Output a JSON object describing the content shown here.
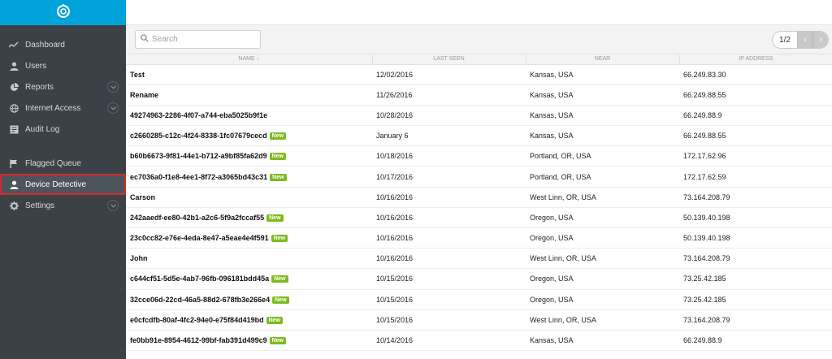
{
  "sidebar": {
    "items": [
      {
        "label": "Dashboard",
        "icon": "chart-line-icon",
        "chevron": false
      },
      {
        "label": "Users",
        "icon": "user-icon",
        "chevron": false
      },
      {
        "label": "Reports",
        "icon": "pie-chart-icon",
        "chevron": true
      },
      {
        "label": "Internet Access",
        "icon": "globe-icon",
        "chevron": true
      },
      {
        "label": "Audit Log",
        "icon": "log-icon",
        "chevron": false
      },
      {
        "label": "Flagged Queue",
        "icon": "flag-icon",
        "chevron": false
      },
      {
        "label": "Device Detective",
        "icon": "user-icon",
        "chevron": false,
        "active": true
      },
      {
        "label": "Settings",
        "icon": "gear-icon",
        "chevron": true
      }
    ]
  },
  "search": {
    "placeholder": "Search"
  },
  "pager": {
    "label": "1/2"
  },
  "table": {
    "columns": [
      "NAME ↓",
      "LAST SEEN",
      "NEAR",
      "IP ADDRESS"
    ],
    "badge_label": "New",
    "rows": [
      {
        "name": "Test",
        "new": false,
        "last_seen": "12/02/2016",
        "near": "Kansas, USA",
        "ip": "66.249.83.30"
      },
      {
        "name": "Rename",
        "new": false,
        "last_seen": "11/26/2016",
        "near": "Kansas, USA",
        "ip": "66.249.88.55"
      },
      {
        "name": "49274963-2286-4f07-a744-eba5025b9f1e",
        "new": false,
        "last_seen": "10/28/2016",
        "near": "Kansas, USA",
        "ip": "66.249.88.9"
      },
      {
        "name": "c2660285-c12c-4f24-8338-1fc07679cecd",
        "new": true,
        "last_seen": "January 6",
        "near": "Kansas, USA",
        "ip": "66.249.88.55"
      },
      {
        "name": "b60b6673-9f81-44e1-b712-a9bf85fa62d9",
        "new": true,
        "last_seen": "10/18/2016",
        "near": "Portland, OR, USA",
        "ip": "172.17.62.96"
      },
      {
        "name": "ec7036a0-f1e8-4ee1-8f72-a3065bd43c31",
        "new": true,
        "last_seen": "10/17/2016",
        "near": "Portland, OR, USA",
        "ip": "172.17.62.59"
      },
      {
        "name": "Carson",
        "new": false,
        "last_seen": "10/16/2016",
        "near": "West Linn, OR, USA",
        "ip": "73.164.208.79"
      },
      {
        "name": "242aaedf-ee80-42b1-a2c6-5f9a2fccaf55",
        "new": true,
        "last_seen": "10/16/2016",
        "near": "Oregon, USA",
        "ip": "50.139.40.198"
      },
      {
        "name": "23c0cc82-e76e-4eda-8e47-a5eae4e4f591",
        "new": true,
        "last_seen": "10/16/2016",
        "near": "Oregon, USA",
        "ip": "50.139.40.198"
      },
      {
        "name": "John",
        "new": false,
        "last_seen": "10/16/2016",
        "near": "West Linn, OR, USA",
        "ip": "73.164.208.79"
      },
      {
        "name": "c644cf51-5d5e-4ab7-96fb-096181bdd45a",
        "new": true,
        "last_seen": "10/15/2016",
        "near": "Oregon, USA",
        "ip": "73.25.42.185"
      },
      {
        "name": "32cce06d-22cd-46a5-88d2-678fb3e266e4",
        "new": true,
        "last_seen": "10/15/2016",
        "near": "Oregon, USA",
        "ip": "73.25.42.185"
      },
      {
        "name": "e0cfcdfb-80af-4fc2-94e0-e75f84d419bd",
        "new": true,
        "last_seen": "10/15/2016",
        "near": "West Linn, OR, USA",
        "ip": "73.164.208.79"
      },
      {
        "name": "fe0bb91e-8954-4612-99bf-fab391d499c9",
        "new": true,
        "last_seen": "10/14/2016",
        "near": "Kansas, USA",
        "ip": "66.249.88.9"
      }
    ]
  }
}
